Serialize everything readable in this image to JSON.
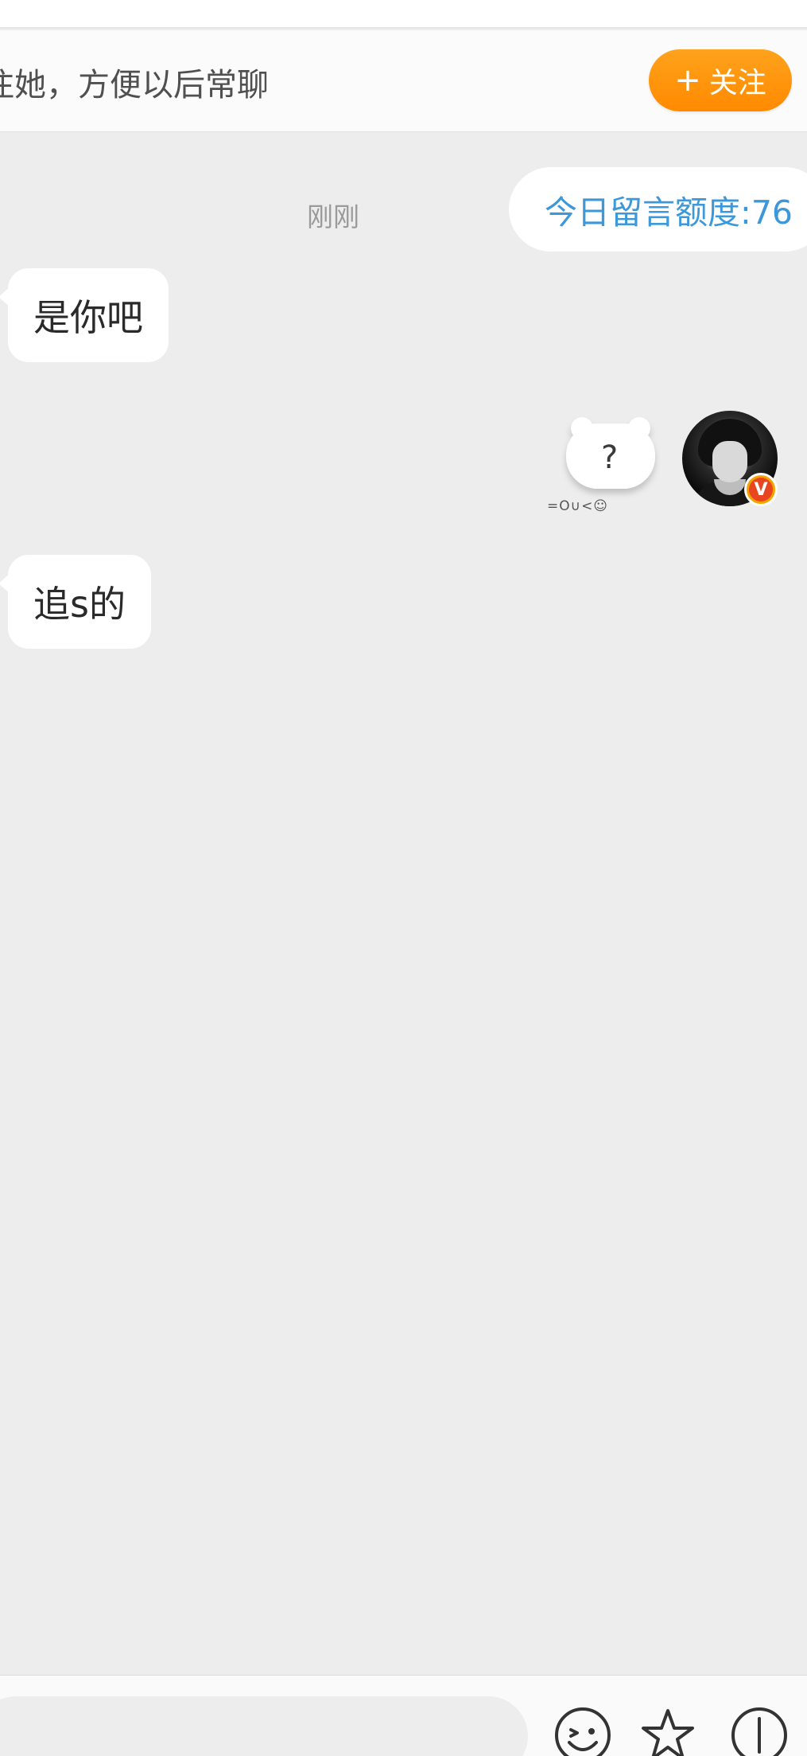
{
  "follow_bar": {
    "text": "注她，方便以后常聊",
    "button_plus": "+",
    "button_label": "关注"
  },
  "quota": {
    "label": "今日留言额度:76"
  },
  "timestamp": "刚刚",
  "messages": [
    {
      "direction": "in",
      "text": "是你吧"
    },
    {
      "direction": "out",
      "type": "sticker",
      "text": "?",
      "caption": "=O∪<☺"
    },
    {
      "direction": "in",
      "text": "追s的"
    }
  ],
  "avatar": {
    "badge": "V"
  },
  "colors": {
    "follow_button": "#ff9410",
    "quota_text": "#3c98d9",
    "background": "#ededed",
    "badge": "#f5a300"
  },
  "icons": {
    "emoji": "emoji-icon",
    "favorite": "star-icon",
    "more": "more-icon"
  }
}
